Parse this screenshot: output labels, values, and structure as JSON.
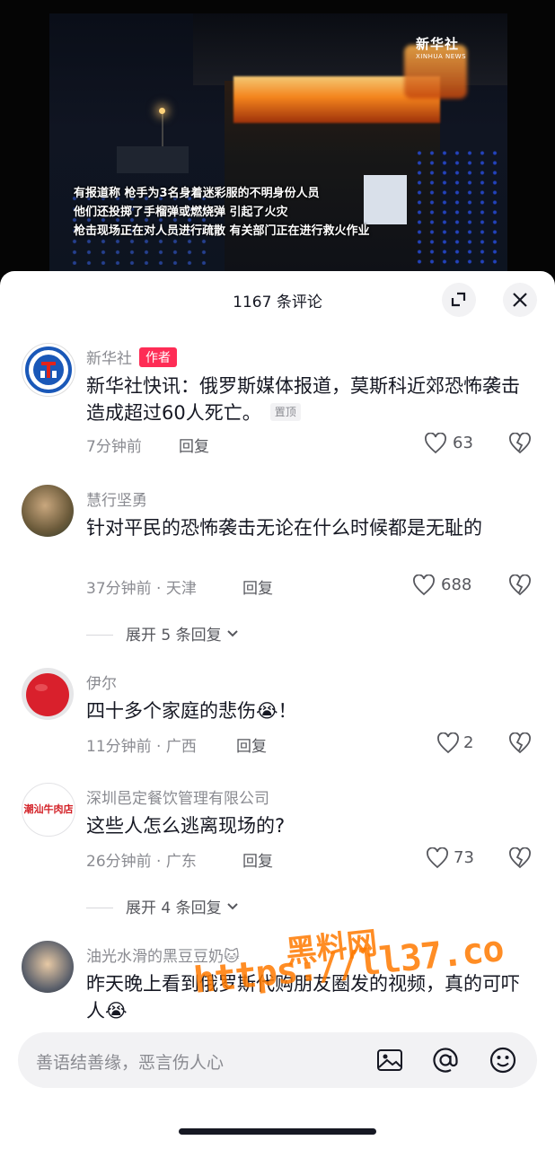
{
  "video": {
    "logo_cn": "新华社",
    "logo_en": "XINHUA NEWS",
    "subtitles": [
      "有报道称 枪手为3名身着迷彩服的不明身份人员",
      "他们还投掷了手榴弹或燃烧弹 引起了火灾",
      "枪击现场正在对人员进行疏散 有关部门正在进行救火作业"
    ]
  },
  "sheet": {
    "title": "1167 条评论",
    "expand_icon": "expand-icon",
    "close_icon": "close-icon"
  },
  "comments": [
    {
      "user": "新华社",
      "author_badge": "作者",
      "text": "新华社快讯：俄罗斯媒体报道，莫斯科近郊恐怖袭击造成超过60人死亡。",
      "pinned": "置顶",
      "meta": "7分钟前",
      "reply": "回复",
      "likes": "63"
    },
    {
      "user": "慧行坚勇",
      "text": "针对平民的恐怖袭击无论在什么时候都是无耻的",
      "meta": "37分钟前 · 天津",
      "reply": "回复",
      "likes": "688",
      "expand": "展开 5 条回复"
    },
    {
      "user": "伊尔",
      "text": "四十多个家庭的悲伤😭！",
      "meta": "11分钟前 · 广西",
      "reply": "回复",
      "likes": "2"
    },
    {
      "user": "深圳邑定餐饮管理有限公司",
      "avatar_text": "潮汕牛肉店",
      "text": "这些人怎么逃离现场的?",
      "meta": "26分钟前 · 广东",
      "reply": "回复",
      "likes": "73",
      "expand": "展开 4 条回复"
    },
    {
      "user": "油光水滑的黑豆豆奶🐱",
      "text": "昨天晚上看到俄罗斯代购朋友圈发的视频，真的可吓人😭"
    }
  ],
  "input": {
    "placeholder": "善语结善缘，恶言伤人心",
    "icons": [
      "image-icon",
      "at-icon",
      "emoji-icon"
    ]
  },
  "watermark": {
    "line1": "黑料网",
    "line2": "https://ll37.co"
  },
  "colors": {
    "accent": "#fe2c55",
    "watermark": "#ff7a00"
  }
}
